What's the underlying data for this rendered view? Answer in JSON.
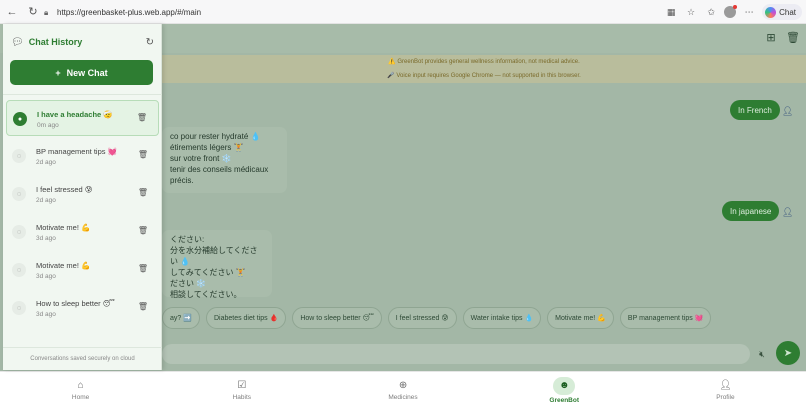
{
  "browser": {
    "url": "https://greenbasket-plus.web.app/#/main",
    "chat_label": "Chat"
  },
  "notices": {
    "disclaimer": "⚠️ GreenBot provides general wellness information, not medical advice.",
    "voice": "🎤 Voice input requires Google Chrome — not supported in this browser."
  },
  "chat": {
    "bubble1": [
      "co pour rester hydraté 💧",
      "étirements légers 🏋",
      "sur votre front ❄️",
      "tenir des conseils médicaux précis."
    ],
    "user1": "In French",
    "user2": "In japanese",
    "bubble2": [
      "ください:",
      "分を水分補給してください 💧",
      "してみてください 🏋",
      "ださい ❄️",
      "相談してください。"
    ]
  },
  "chips": [
    "ay? ➡️",
    "Diabetes diet tips 🩸",
    "How to sleep better 😴",
    "I feel stressed 😰",
    "Water intake tips 💧",
    "Motivate me! 💪",
    "BP management tips 💓"
  ],
  "sidebar": {
    "title": "Chat History",
    "new_chat": "New Chat",
    "footer": "Conversations saved securely on cloud",
    "items": [
      {
        "title": "I have a headache 🤕",
        "time": "0m ago"
      },
      {
        "title": "BP management tips 💓",
        "time": "2d ago"
      },
      {
        "title": "I feel stressed 😰",
        "time": "2d ago"
      },
      {
        "title": "Motivate me! 💪",
        "time": "3d ago"
      },
      {
        "title": "Motivate me! 💪",
        "time": "3d ago"
      },
      {
        "title": "How to sleep better 😴",
        "time": "3d ago"
      }
    ]
  },
  "nav": {
    "home": "Home",
    "habits": "Habits",
    "medicines": "Medicines",
    "greenbot": "GreenBot",
    "profile": "Profile"
  },
  "colors": {
    "brand_green": "#2e7d32",
    "overlay": "#a3b7a6",
    "sidebar_bg": "#f1f7f1"
  }
}
